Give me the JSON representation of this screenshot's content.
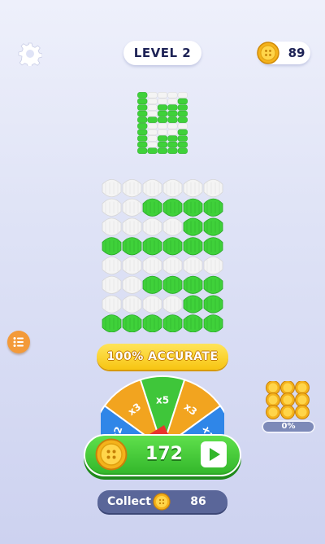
{
  "header": {
    "level_label": "LEVEL 2",
    "coins": "89",
    "settings_icon": "gear-icon",
    "coin_icon": "coin-icon"
  },
  "board": {
    "preview_pattern": [
      "GWWWW",
      "GWWWG",
      "GWGGG",
      "GWGGG",
      "GGGGG",
      "GWWWW",
      "GWWWG",
      "GWGGG",
      "GWGGG",
      "GGGGG"
    ],
    "knit_pattern": [
      "WWWWWW",
      "WWGGGG",
      "WWWWGG",
      "GGGGGG",
      "WWWWWW",
      "WWGGGG",
      "WWWWGG",
      "GGGGGG"
    ],
    "colors": {
      "white": "#f4f4f4",
      "green": "#3fd13a"
    }
  },
  "accuracy_banner": "100% ACCURATE",
  "wheel": {
    "segments": [
      "x2",
      "x3",
      "x5",
      "x3",
      "x2"
    ],
    "segment_colors": [
      "#2f86e8",
      "#f2a41f",
      "#3fc63a",
      "#f2a41f",
      "#2f86e8"
    ]
  },
  "side": {
    "list_icon": "list-icon",
    "progress_percent": "0%",
    "progress_value": 0
  },
  "claim": {
    "value": "172",
    "play_icon": "play-icon"
  },
  "collect": {
    "label": "Collect",
    "value": "86"
  }
}
